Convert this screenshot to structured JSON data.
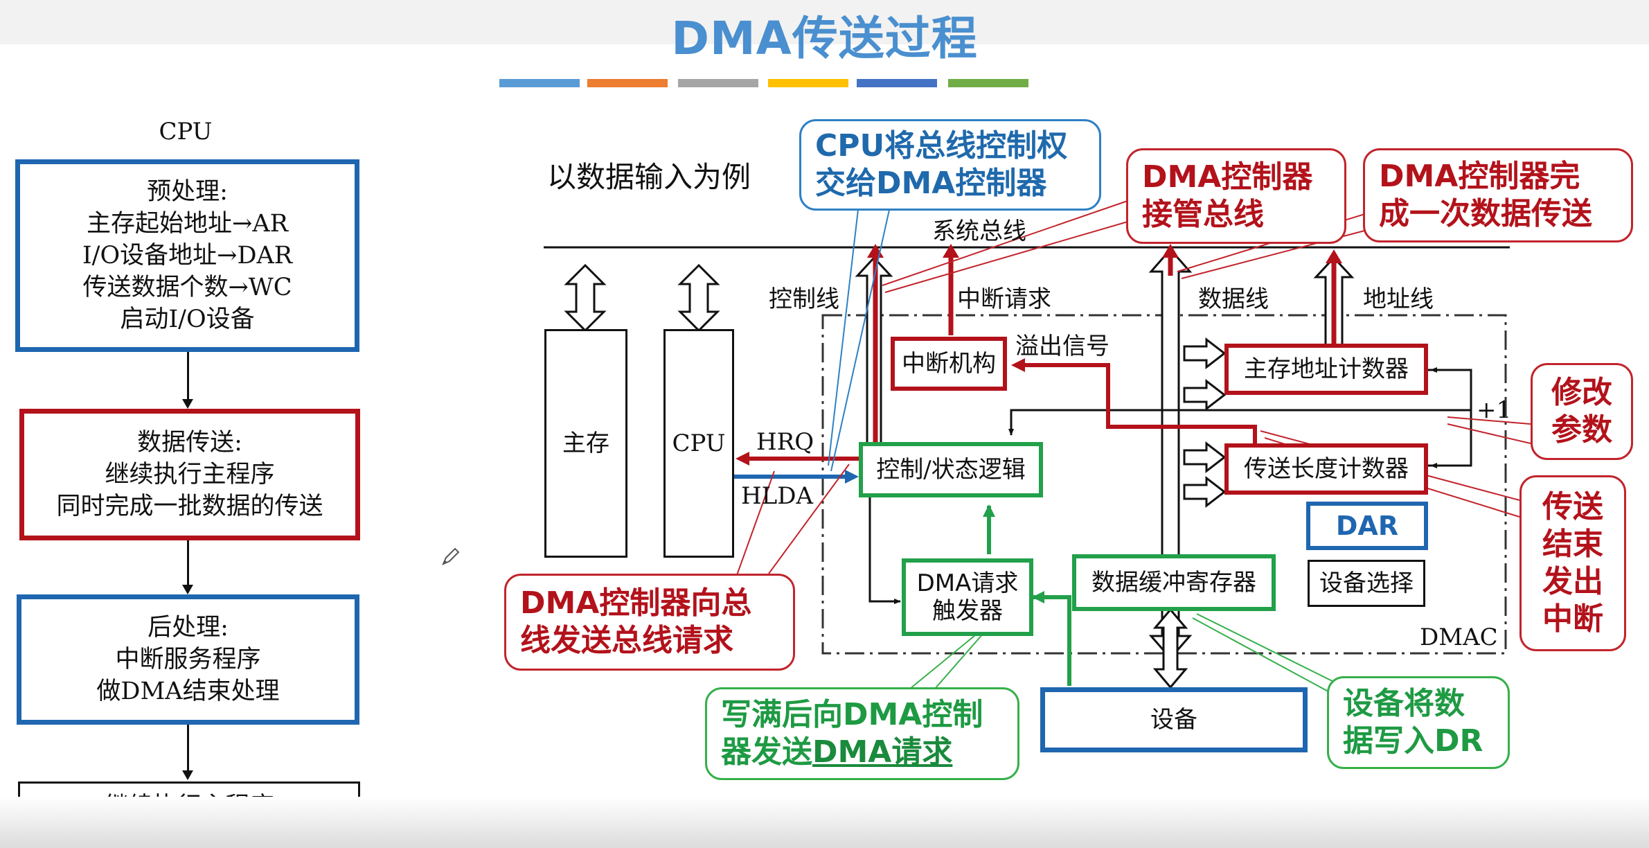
{
  "header": {
    "title": "DMA传送过程",
    "stripe_colors": [
      "#5b9bd5",
      "#ed7d31",
      "#a5a5a5",
      "#ffc000",
      "#4472c4",
      "#70ad47"
    ]
  },
  "flowchart": {
    "cpu_label": "CPU",
    "preprocess": [
      "预处理:",
      "主存起始地址→AR",
      "I/O设备地址→DAR",
      "传送数据个数→WC",
      "启动I/O设备"
    ],
    "transfer": [
      "数据传送:",
      "继续执行主程序",
      "同时完成一批数据的传送"
    ],
    "postprocess": [
      "后处理:",
      "中断服务程序",
      "做DMA结束处理"
    ],
    "continue": "继续执行主程序"
  },
  "diagram": {
    "example_label": "以数据输入为例",
    "system_bus": "系统总线",
    "control_line": "控制线",
    "interrupt_request": "中断请求",
    "data_line": "数据线",
    "address_line": "地址线",
    "main_memory": "主存",
    "cpu": "CPU",
    "hrq": "HRQ",
    "hlda": "HLDA",
    "interrupt_unit": "中断机构",
    "overflow_signal": "溢出信号",
    "addr_counter": "主存地址计数器",
    "plus_one": "+1",
    "length_counter": "传送长度计数器",
    "control_logic": "控制/状态逻辑",
    "dma_trigger": [
      "DMA请求",
      "触发器"
    ],
    "data_buffer": "数据缓冲寄存器",
    "dar": "DAR",
    "device_select": "设备选择",
    "dmac": "DMAC",
    "device": "设备"
  },
  "callouts": {
    "cpu_hand_over": [
      "CPU将总线控制权",
      "交给DMA控制器"
    ],
    "dma_take_bus": [
      "DMA控制器",
      "接管总线"
    ],
    "dma_complete": [
      "DMA控制器完",
      "成一次数据传送"
    ],
    "modify_params": [
      "修改",
      "参数"
    ],
    "end_interrupt": [
      "传送",
      "结束",
      "发出",
      "中断"
    ],
    "bus_request": [
      "DMA控制器向总",
      "线发送总线请求"
    ],
    "write_full": {
      "line1": "写满后向DMA控制",
      "line2_prefix": "器发送",
      "line2_emph": "DMA请求"
    },
    "device_write": [
      "设备将数",
      "据写入DR"
    ]
  }
}
